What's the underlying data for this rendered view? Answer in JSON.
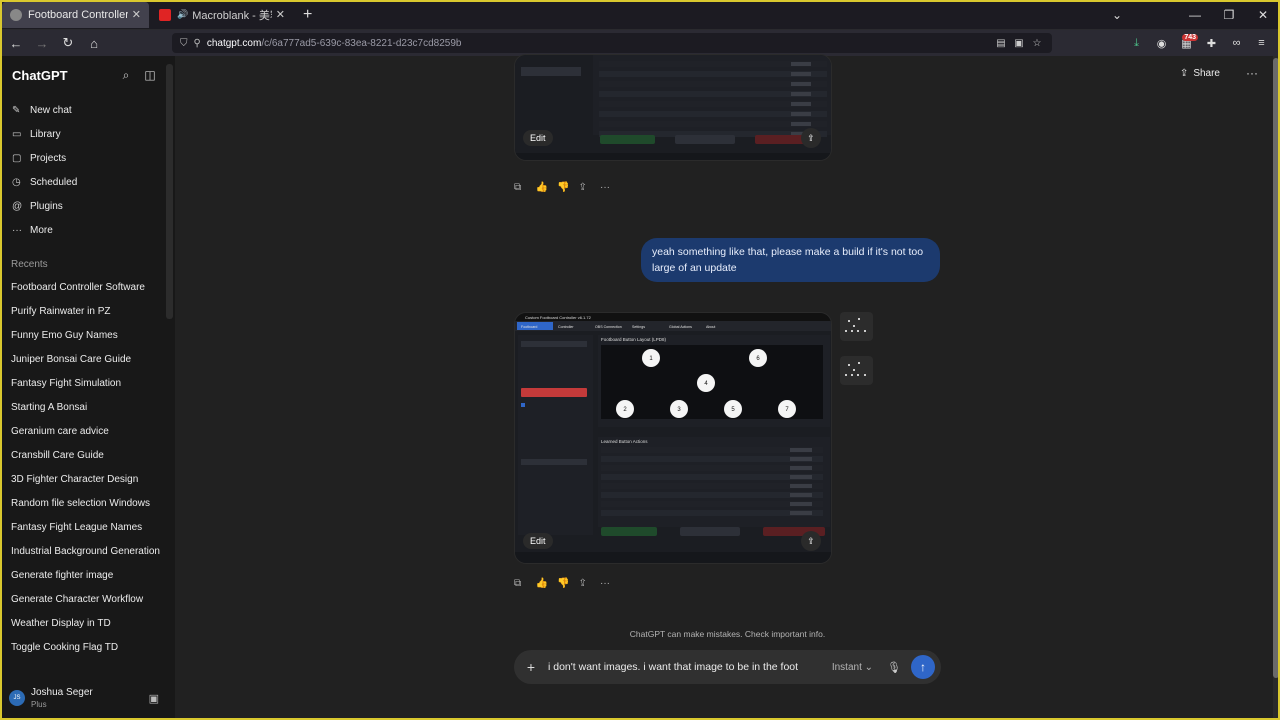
{
  "browser": {
    "tabs": [
      {
        "title": "Footboard Controller Software",
        "active": true
      },
      {
        "title": "Macroblank - 美容師 COLLE",
        "active": false
      }
    ],
    "url_host": "chatgpt.com",
    "url_path": "/c/6a777ad5-639c-83ea-8221-d23c7cd8259b",
    "extension_badge": "743"
  },
  "sidebar": {
    "brand": "ChatGPT",
    "nav": [
      {
        "label": "New chat",
        "icon": "edit-icon"
      },
      {
        "label": "Library",
        "icon": "library-icon"
      },
      {
        "label": "Projects",
        "icon": "folder-icon"
      },
      {
        "label": "Scheduled",
        "icon": "clock-icon"
      },
      {
        "label": "Plugins",
        "icon": "plugin-icon"
      },
      {
        "label": "More",
        "icon": "dots-icon"
      }
    ],
    "recents_heading": "Recents",
    "recents": [
      "Footboard Controller Software",
      "Purify Rainwater in PZ",
      "Funny Emo Guy Names",
      "Juniper Bonsai Care Guide",
      "Fantasy Fight Simulation",
      "Starting A Bonsai",
      "Geranium care advice",
      "Cransbill Care Guide",
      "3D Fighter Character Design",
      "Random file selection Windows",
      "Fantasy Fight League Names",
      "Industrial Background Generation",
      "Generate fighter image",
      "Generate Character Workflow",
      "Weather Display in TD",
      "Toggle Cooking Flag TD"
    ],
    "user": {
      "initials": "JS",
      "name": "Joshua Seger",
      "plan": "Plus"
    }
  },
  "header": {
    "share_label": "Share"
  },
  "conversation": {
    "image_edit_label": "Edit",
    "user_message": "yeah something like that, please make a build if it's not too large of an update",
    "image_app_title": "Custom Footboard Controller v6.1.72",
    "image_tabs": [
      "Footboard",
      "Controller",
      "OBS Connection",
      "Settings",
      "Global Actions",
      "About"
    ],
    "image_layout_title": "Footboard Button Layout (LPD8)",
    "image_actions_title": "Learned Button Actions",
    "image_buttons": [
      "1",
      "6",
      "4",
      "2",
      "3",
      "5",
      "7"
    ]
  },
  "footer": {
    "disclaimer": "ChatGPT can make mistakes. Check important info.",
    "composer_text": "i don't want images. i want that image to be in the foot",
    "model_label": "Instant"
  }
}
